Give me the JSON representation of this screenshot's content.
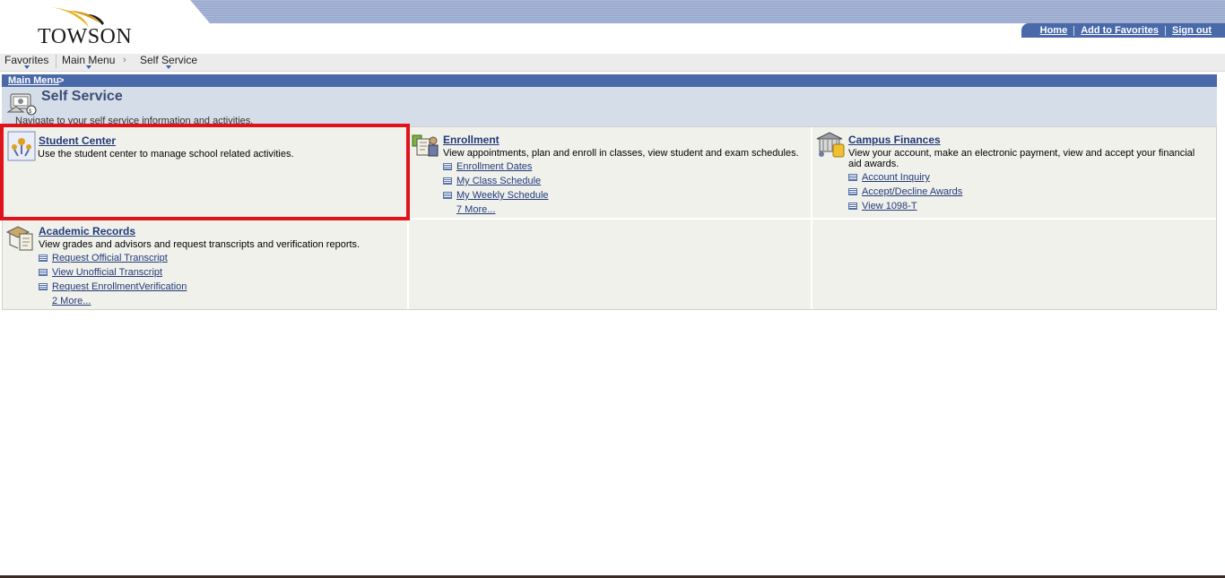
{
  "logo": {
    "text": "TOWSON"
  },
  "top_links": {
    "home": "Home",
    "favorites": "Add to Favorites",
    "signout": "Sign out"
  },
  "nav": {
    "favorites": "Favorites",
    "main_menu": "Main Menu",
    "self_service": "Self Service"
  },
  "breadcrumb": {
    "main_menu": "Main Menu",
    "sep": ">"
  },
  "page": {
    "title": "Self Service",
    "description": "Navigate to your self service information and activities."
  },
  "sections": {
    "student_center": {
      "title": "Student Center",
      "description": "Use the student center to manage school related activities."
    },
    "enrollment": {
      "title": "Enrollment",
      "description": "View appointments, plan and enroll in classes, view student and exam schedules.",
      "links": [
        "Enrollment Dates",
        "My Class Schedule",
        "My Weekly Schedule"
      ],
      "more": "7 More..."
    },
    "campus_finances": {
      "title": "Campus Finances",
      "description": "View your account, make an electronic payment, view and accept your financial aid awards.",
      "links": [
        "Account Inquiry",
        "Accept/Decline Awards",
        "View 1098-T"
      ]
    },
    "academic_records": {
      "title": "Academic Records",
      "description": "View grades and advisors and request transcripts and verification reports.",
      "links": [
        "Request Official Transcript",
        "View Unofficial Transcript",
        "Request EnrollmentVerification"
      ],
      "more": "2 More..."
    }
  },
  "colors": {
    "header_blue": "#4a69a8",
    "highlight_red": "#e0131b",
    "cell_bg": "#f1f1ec",
    "link": "#223a7a"
  }
}
